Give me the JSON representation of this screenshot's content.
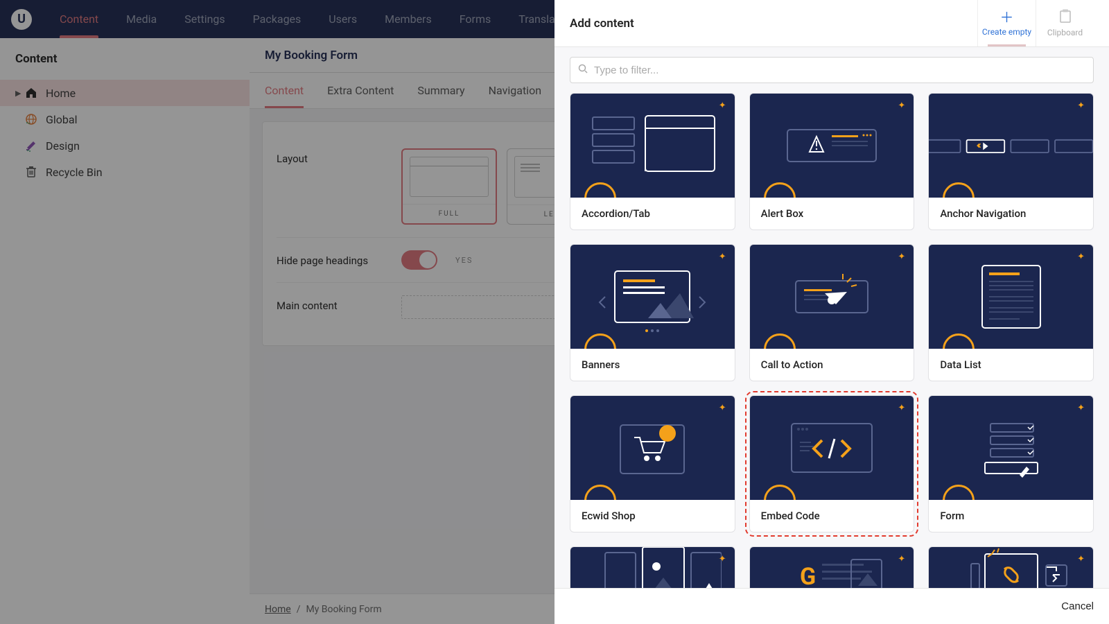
{
  "topnav": [
    "Content",
    "Media",
    "Settings",
    "Packages",
    "Users",
    "Members",
    "Forms",
    "Translation"
  ],
  "topnav_active": 0,
  "leftpanel": {
    "header": "Content",
    "items": [
      {
        "label": "Home",
        "icon": "home",
        "active": true,
        "caret": true
      },
      {
        "label": "Global",
        "icon": "globe"
      },
      {
        "label": "Design",
        "icon": "design"
      },
      {
        "label": "Recycle Bin",
        "icon": "bin"
      }
    ]
  },
  "main": {
    "title": "My Booking Form",
    "subtabs": [
      "Content",
      "Extra Content",
      "Summary",
      "Navigation"
    ],
    "subtab_active": 0,
    "fields": {
      "layout_label": "Layout",
      "layout_options": [
        {
          "id": "full",
          "caption": "FULL",
          "selected": true
        },
        {
          "id": "left",
          "caption": "LEFT"
        }
      ],
      "hide_label": "Hide page headings",
      "hide_value": "YES",
      "main_content_label": "Main content"
    }
  },
  "breadcrumb": {
    "root": "Home",
    "current": "My Booking Form"
  },
  "overlay": {
    "title": "Add content",
    "action_primary": "Create empty",
    "action_secondary": "Clipboard",
    "filter_placeholder": "Type to filter...",
    "cards": [
      {
        "label": "Accordion/Tab",
        "thumb": "accordion"
      },
      {
        "label": "Alert Box",
        "thumb": "alert"
      },
      {
        "label": "Anchor Navigation",
        "thumb": "anchor"
      },
      {
        "label": "Banners",
        "thumb": "banner"
      },
      {
        "label": "Call to Action",
        "thumb": "cta"
      },
      {
        "label": "Data List",
        "thumb": "datalist"
      },
      {
        "label": "Ecwid Shop",
        "thumb": "shop"
      },
      {
        "label": "Embed Code",
        "thumb": "embed",
        "highlight": true
      },
      {
        "label": "Form",
        "thumb": "form"
      },
      {
        "label": "",
        "thumb": "image"
      },
      {
        "label": "",
        "thumb": "google"
      },
      {
        "label": "",
        "thumb": "link"
      }
    ],
    "cancel": "Cancel"
  },
  "colors": {
    "brand": "#1b264f",
    "accent": "#e2747a",
    "gold": "#f4a11a",
    "link": "#2f72d6"
  }
}
